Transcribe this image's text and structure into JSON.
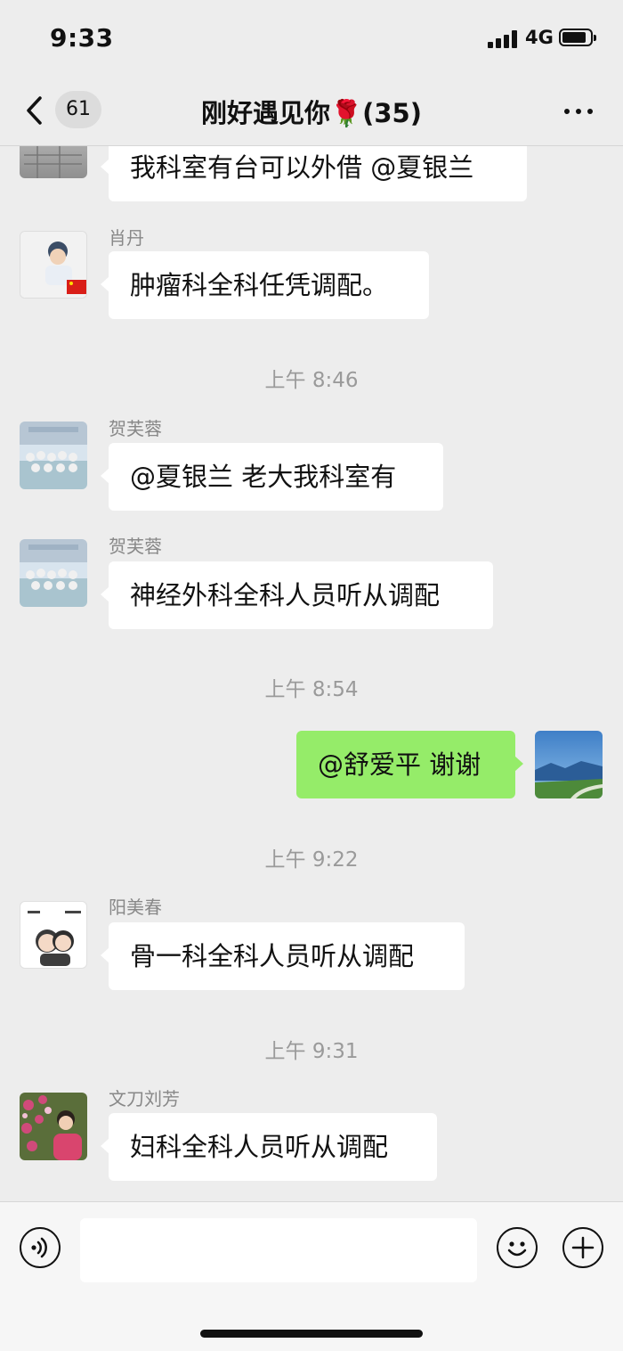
{
  "status_bar": {
    "time": "9:33",
    "network": "4G"
  },
  "nav": {
    "back_count": "61",
    "title": "刚好遇见你🌹(35)"
  },
  "messages": [
    {
      "type": "text",
      "text": "我科室有台可以外借 @夏银兰"
    },
    {
      "type": "text",
      "sender": "肖丹",
      "text": "肿瘤科全科任凭调配。"
    },
    {
      "type": "time",
      "text": "上午 8:46"
    },
    {
      "type": "text",
      "sender": "贺芙蓉",
      "text": "@夏银兰 老大我科室有"
    },
    {
      "type": "text",
      "sender": "贺芙蓉",
      "text": "神经外科全科人员听从调配"
    },
    {
      "type": "time",
      "text": "上午 8:54"
    },
    {
      "type": "text",
      "mine": true,
      "text": "@舒爱平 谢谢"
    },
    {
      "type": "time",
      "text": "上午 9:22"
    },
    {
      "type": "text",
      "sender": "阳美春",
      "text": "骨一科全科人员听从调配"
    },
    {
      "type": "time",
      "text": "上午 9:31"
    },
    {
      "type": "text",
      "sender": "文刀刘芳",
      "text": "妇科全科人员听从调配"
    }
  ],
  "input": {
    "placeholder": ""
  },
  "icons": {
    "back": "chevron-left-icon",
    "more": "more-dots-icon",
    "voice": "voice-icon",
    "emoji": "emoji-icon",
    "add": "plus-icon"
  },
  "colors": {
    "background": "#ededed",
    "my_bubble": "#95ec69",
    "their_bubble": "#ffffff"
  }
}
